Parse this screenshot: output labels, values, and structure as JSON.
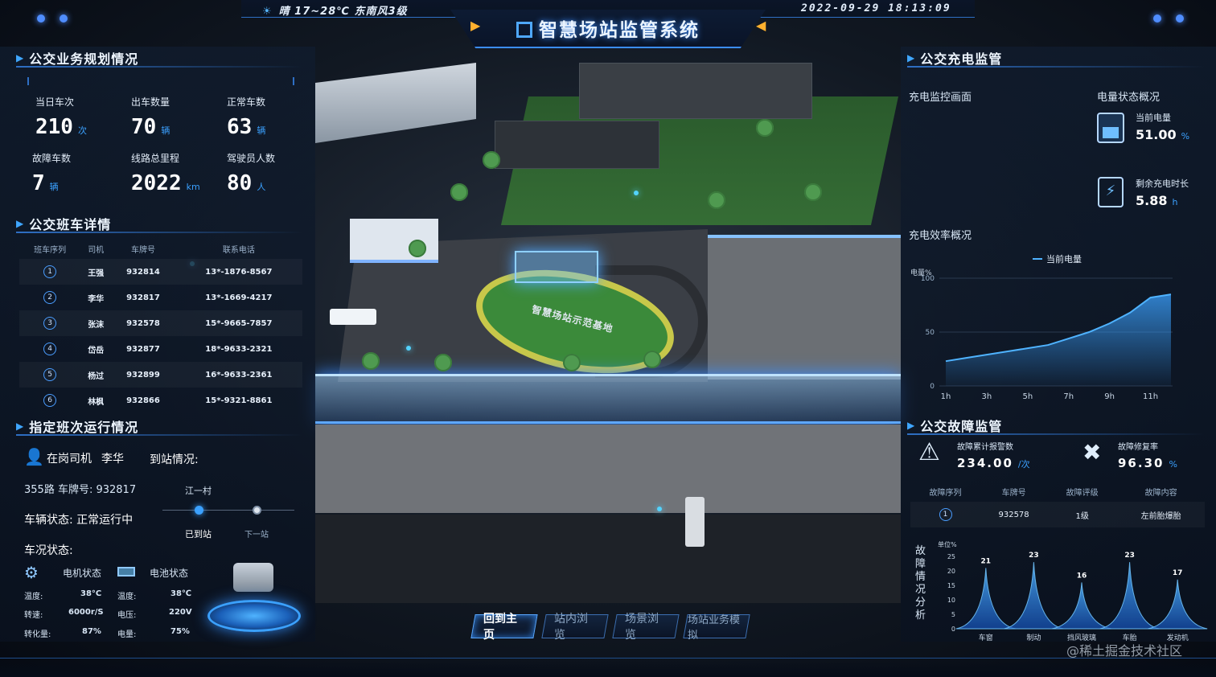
{
  "header": {
    "weather": "晴 17~28℃ 东南风3级",
    "title": "智慧场站监管系统",
    "datetime": "2022-09-29 18:13:09"
  },
  "left": {
    "plan": {
      "title": "公交业务规划情况",
      "stats": [
        {
          "label": "当日车次",
          "value": "210",
          "unit": "次"
        },
        {
          "label": "出车数量",
          "value": "70",
          "unit": "辆"
        },
        {
          "label": "正常车数",
          "value": "63",
          "unit": "辆"
        },
        {
          "label": "故障车数",
          "value": "7",
          "unit": "辆"
        },
        {
          "label": "线路总里程",
          "value": "2022",
          "unit": "km"
        },
        {
          "label": "驾驶员人数",
          "value": "80",
          "unit": "人"
        }
      ]
    },
    "shifts": {
      "title": "公交班车详情",
      "headers": [
        "班车序列",
        "司机",
        "车牌号",
        "联系电话"
      ],
      "rows": [
        {
          "idx": "1",
          "driver": "王强",
          "plate": "932814",
          "phone": "13*-1876-8567"
        },
        {
          "idx": "2",
          "driver": "李华",
          "plate": "932817",
          "phone": "13*-1669-4217"
        },
        {
          "idx": "3",
          "driver": "张沫",
          "plate": "932578",
          "phone": "15*-9665-7857"
        },
        {
          "idx": "4",
          "driver": "岱岳",
          "plate": "932877",
          "phone": "18*-9633-2321"
        },
        {
          "idx": "5",
          "driver": "杨过",
          "plate": "932899",
          "phone": "16*-9633-2361"
        },
        {
          "idx": "6",
          "driver": "林枫",
          "plate": "932866",
          "phone": "15*-9321-8861"
        }
      ]
    },
    "run": {
      "title": "指定班次运行情况",
      "driver_label": "在岗司机",
      "driver_name": "李华",
      "arrival_label": "到站情况:",
      "route": "355路 车牌号:",
      "plate": "932817",
      "vehicle_status": "车辆状态: 正常运行中",
      "current_stop": "江一村",
      "arrived": "已到站",
      "next": "下一站",
      "cond_label": "车况状态:",
      "motor_label": "电机状态",
      "battery_label": "电池状态",
      "motor": [
        {
          "k": "温度:",
          "v": "38°C"
        },
        {
          "k": "转速:",
          "v": "6000r/S"
        },
        {
          "k": "转化量:",
          "v": "87%"
        }
      ],
      "battery": [
        {
          "k": "温度:",
          "v": "38℃"
        },
        {
          "k": "电压:",
          "v": "220V"
        },
        {
          "k": "电量:",
          "v": "75%"
        }
      ]
    }
  },
  "right": {
    "charge": {
      "title": "公交充电监管",
      "monitor_label": "充电监控画面",
      "status_label": "电量状态概况",
      "current_label": "当前电量",
      "current_value": "51.00",
      "current_unit": "%",
      "remain_label": "剩余充电时长",
      "remain_value": "5.88",
      "remain_unit": "h",
      "eff_label": "充电效率概况"
    },
    "fault": {
      "title": "公交故障监管",
      "alarm_label": "故障累计报警数",
      "alarm_value": "234.00",
      "alarm_unit": "/次",
      "repair_label": "故障修复率",
      "repair_value": "96.30",
      "repair_unit": "%",
      "headers": [
        "故障序列",
        "车牌号",
        "故障评级",
        "故障内容"
      ],
      "rows": [
        {
          "idx": "1",
          "plate": "932578",
          "level": "1级",
          "content": "左前胎爆胎"
        }
      ],
      "analysis_label": "故障情况分析"
    }
  },
  "scene": {
    "label": "智慧场站示范基地"
  },
  "nav": {
    "buttons": [
      "回到主页",
      "站内浏览",
      "场景浏览",
      "场站业务模拟"
    ]
  },
  "watermark": "@稀土掘金技术社区",
  "colors": {
    "accent": "#3ba1ff",
    "line": "#3b8dff",
    "warn": "#ffb02e"
  },
  "chart_data": [
    {
      "type": "line",
      "ylabel": "电量%",
      "ylim": [
        0,
        100
      ],
      "yticks": [
        0,
        50,
        100
      ],
      "categories": [
        "1h",
        "2h",
        "3h",
        "4h",
        "5h",
        "6h",
        "7h",
        "8h",
        "9h",
        "10h",
        "11h",
        "12h"
      ],
      "xticks": [
        "1h",
        "3h",
        "5h",
        "7h",
        "9h",
        "11h"
      ],
      "legend": "top",
      "series": [
        {
          "name": "当前电量",
          "values": [
            23,
            26,
            29,
            32,
            35,
            38,
            44,
            50,
            58,
            68,
            82,
            85
          ]
        }
      ]
    },
    {
      "type": "area",
      "ylabel": "单位%",
      "ylim": [
        0,
        25
      ],
      "yticks": [
        0,
        5,
        10,
        15,
        20,
        25
      ],
      "categories": [
        "车窗",
        "制动",
        "挡风玻璃",
        "车胎",
        "发动机"
      ],
      "values": [
        21,
        23,
        16,
        23,
        17
      ]
    }
  ]
}
